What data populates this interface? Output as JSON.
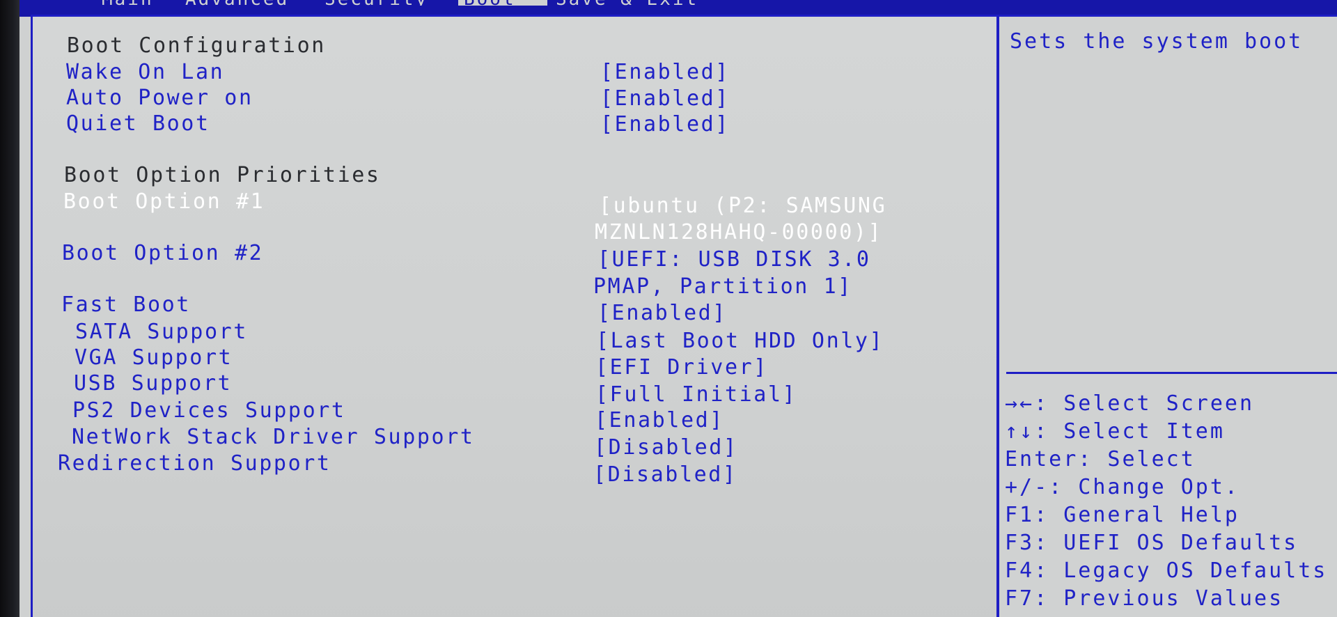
{
  "tabs": [
    {
      "label": "Main"
    },
    {
      "label": "Advanced"
    },
    {
      "label": "Security"
    },
    {
      "label": "Boot"
    },
    {
      "label": "Save & Exit"
    }
  ],
  "sections": {
    "boot_configuration": "Boot Configuration",
    "boot_option_priorities": "Boot Option Priorities"
  },
  "settings": {
    "wake_on_lan": {
      "label": "Wake On Lan",
      "value": "[Enabled]"
    },
    "auto_power_on": {
      "label": "Auto Power on",
      "value": "[Enabled]"
    },
    "quiet_boot": {
      "label": "Quiet Boot",
      "value": "[Enabled]"
    },
    "boot_option_1": {
      "label": "Boot Option #1",
      "value_line1": "[ubuntu (P2: SAMSUNG",
      "value_line2": "MZNLN128HAHQ-00000)]"
    },
    "boot_option_2": {
      "label": "Boot Option #2",
      "value_line1": "[UEFI:  USB DISK 3.0",
      "value_line2": "PMAP, Partition 1]"
    },
    "fast_boot": {
      "label": "Fast Boot",
      "value": "[Enabled]"
    },
    "sata_support": {
      "label": "SATA Support",
      "value": "[Last Boot HDD Only]"
    },
    "vga_support": {
      "label": "VGA Support",
      "value": "[EFI Driver]"
    },
    "usb_support": {
      "label": "USB Support",
      "value": "[Full Initial]"
    },
    "ps2_devices_support": {
      "label": "PS2 Devices Support",
      "value": "[Enabled]"
    },
    "network_stack_driver_support": {
      "label": "NetWork Stack Driver Support",
      "value": "[Disabled]"
    },
    "redirection_support": {
      "label": "Redirection Support",
      "value": "[Disabled]"
    }
  },
  "description": "Sets the system boot",
  "help": [
    "→←: Select Screen",
    "↑↓: Select Item",
    "Enter: Select",
    "+/-: Change Opt.",
    "F1: General Help",
    "F3: UEFI OS Defaults",
    "F4: Legacy OS Defaults",
    "F7: Previous Values"
  ],
  "colors": {
    "bios_blue": "#1f22c6",
    "panel_gray": "#cfd1d1",
    "selected_text": "#ffffff",
    "header_text": "#2a2c30"
  }
}
